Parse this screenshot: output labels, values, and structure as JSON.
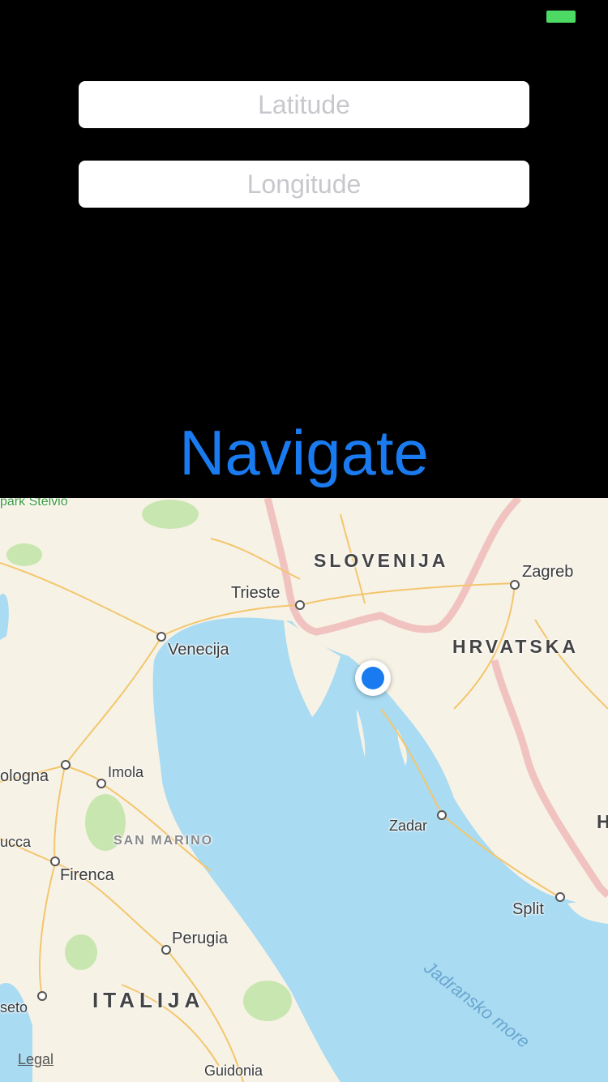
{
  "status_bar": {
    "battery_color": "#4cd964"
  },
  "form": {
    "latitude": {
      "value": "",
      "placeholder": "Latitude"
    },
    "longitude": {
      "value": "",
      "placeholder": "Longitude"
    },
    "navigate_label": "Navigate",
    "accent_color": "#1a7bf0"
  },
  "map": {
    "labels": {
      "park": "park Stelvio",
      "slovenija": "SLOVENIJA",
      "zagreb": "Zagreb",
      "trieste": "Trieste",
      "venecija": "Venecija",
      "hrvatska": "HRVATSKA",
      "bologna": "ologna",
      "imola": "Imola",
      "san_marino": "SAN MARINO",
      "lucca": "ucca",
      "firenca": "Firenca",
      "zadar": "Zadar",
      "split": "Split",
      "perugia": "Perugia",
      "pesaro": "seto",
      "italija": "ITALIJA",
      "sea": "Jadransko more",
      "guidonia": "Guidonia",
      "edge_h": "H"
    },
    "legal": "Legal",
    "user_location_color": "#1a7bf0"
  }
}
